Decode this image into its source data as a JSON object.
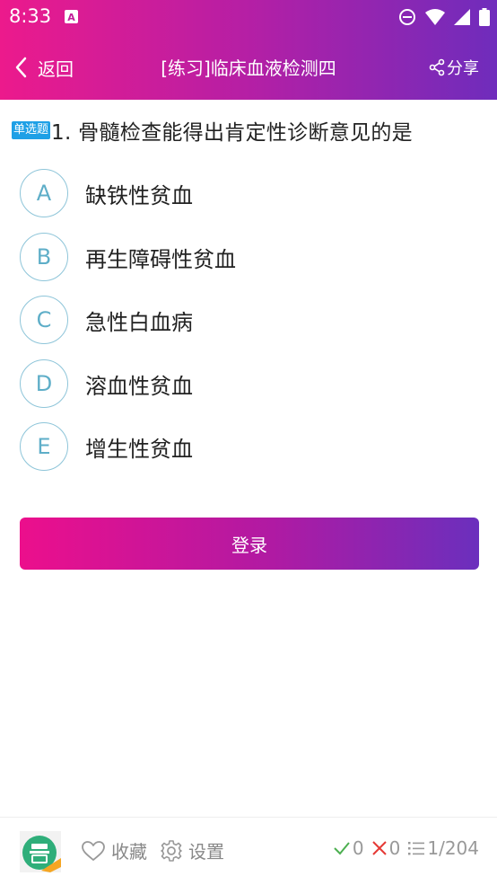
{
  "status_bar": {
    "time": "8:33",
    "icons": [
      "notification-a-icon",
      "do-not-disturb-icon",
      "wifi-icon",
      "signal-icon",
      "battery-icon"
    ]
  },
  "header": {
    "back_label": "返回",
    "title": "[练习]临床血液检测四",
    "share_label": "分享",
    "gradient_colors": [
      "#ec1a8c",
      "#6f2cbc"
    ]
  },
  "question": {
    "type_badge": "单选题",
    "text": "1. 骨髓检查能得出肯定性诊断意见的是",
    "options": [
      {
        "letter": "A",
        "text": "缺铁性贫血"
      },
      {
        "letter": "B",
        "text": "再生障碍性贫血"
      },
      {
        "letter": "C",
        "text": "急性白血病"
      },
      {
        "letter": "D",
        "text": "溶血性贫血"
      },
      {
        "letter": "E",
        "text": "增生性贫血"
      }
    ]
  },
  "login_button": "登录",
  "footer": {
    "favorite_label": "收藏",
    "settings_label": "设置",
    "correct_count": "0",
    "wrong_count": "0",
    "progress": "1/204",
    "colors": {
      "correct": "#4caf50",
      "wrong": "#e53935",
      "badge": "#1ea0e6"
    }
  }
}
